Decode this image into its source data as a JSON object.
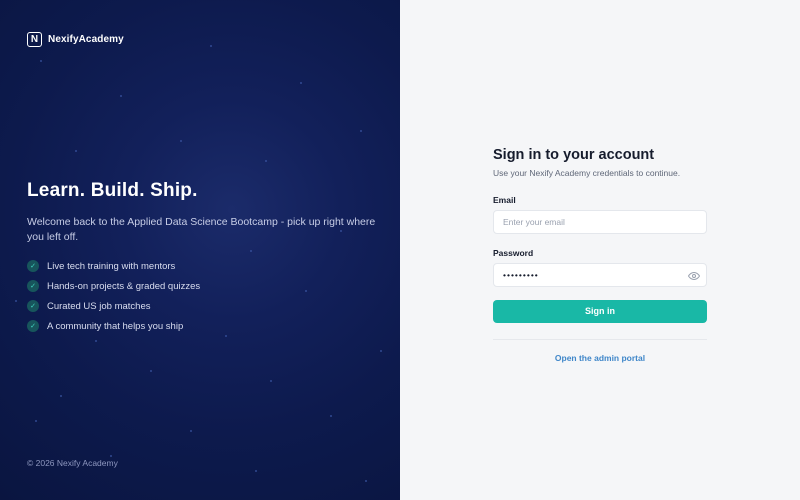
{
  "brand": {
    "logo_letter": "N",
    "name": "NexifyAcademy"
  },
  "hero": {
    "title": "Learn. Build. Ship.",
    "description": "Welcome back to the Applied Data Science Bootcamp - pick up right where you left off.",
    "check_symbol": "✓",
    "features": [
      "Live tech training with mentors",
      "Hands-on projects & graded quizzes",
      "Curated US job matches",
      "A community that helps you ship"
    ]
  },
  "footer": {
    "copyright": "© 2026 Nexify Academy"
  },
  "form": {
    "title": "Sign in to your account",
    "subtitle": "Use your Nexify Academy credentials to continue.",
    "email": {
      "label": "Email",
      "placeholder": "Enter your email",
      "value": ""
    },
    "password": {
      "label": "Password",
      "value": "password1",
      "masked": "•••••••••",
      "toggle_icon": "eye-icon"
    },
    "submit_label": "Sign in",
    "admin_link": "Open the admin portal"
  },
  "colors": {
    "left_background": "#0d1a4d",
    "accent": "#19b8a6",
    "link": "#3f86c9",
    "right_background": "#f5f6f8"
  }
}
